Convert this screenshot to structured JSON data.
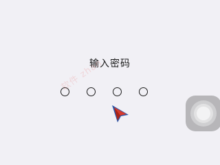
{
  "screen": {
    "title": "输入密码"
  },
  "passcode": {
    "digits": 4,
    "entered": 0
  },
  "watermark": {
    "text": "软件 zhan"
  },
  "icons": {
    "cursor": "pointer-cursor-icon",
    "assistive_touch": "assistive-touch-icon"
  },
  "colors": {
    "background": "#f1f0f5",
    "dot_stroke": "#1c1c1c",
    "cursor_fill": "#d63a2c",
    "cursor_edge": "#2a55a8"
  }
}
